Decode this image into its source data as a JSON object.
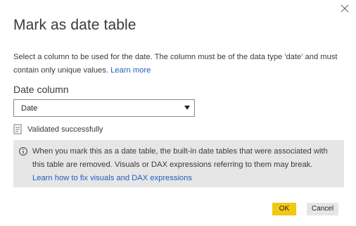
{
  "dialog": {
    "title": "Mark as date table",
    "description": "Select a column to be used for the date. The column must be of the data type 'date' and must contain only unique values.",
    "learn_more": "Learn more",
    "close_icon": "close-icon"
  },
  "date_column": {
    "label": "Date column",
    "selected": "Date",
    "caret_icon": "caret-down-icon"
  },
  "validation": {
    "icon": "document-check-icon",
    "text": "Validated successfully"
  },
  "info_box": {
    "icon": "info-circle-icon",
    "text": "When you mark this as a date table, the built-in date tables that were associated with this table are removed. Visuals or DAX expressions referring to them may break.",
    "link": "Learn how to fix visuals and DAX expressions"
  },
  "buttons": {
    "ok": "OK",
    "cancel": "Cancel"
  },
  "colors": {
    "ok_button": "#f2c811",
    "cancel_button": "#e6e6e6",
    "info_background": "#e6e6e6",
    "link": "#1f5fbf"
  }
}
